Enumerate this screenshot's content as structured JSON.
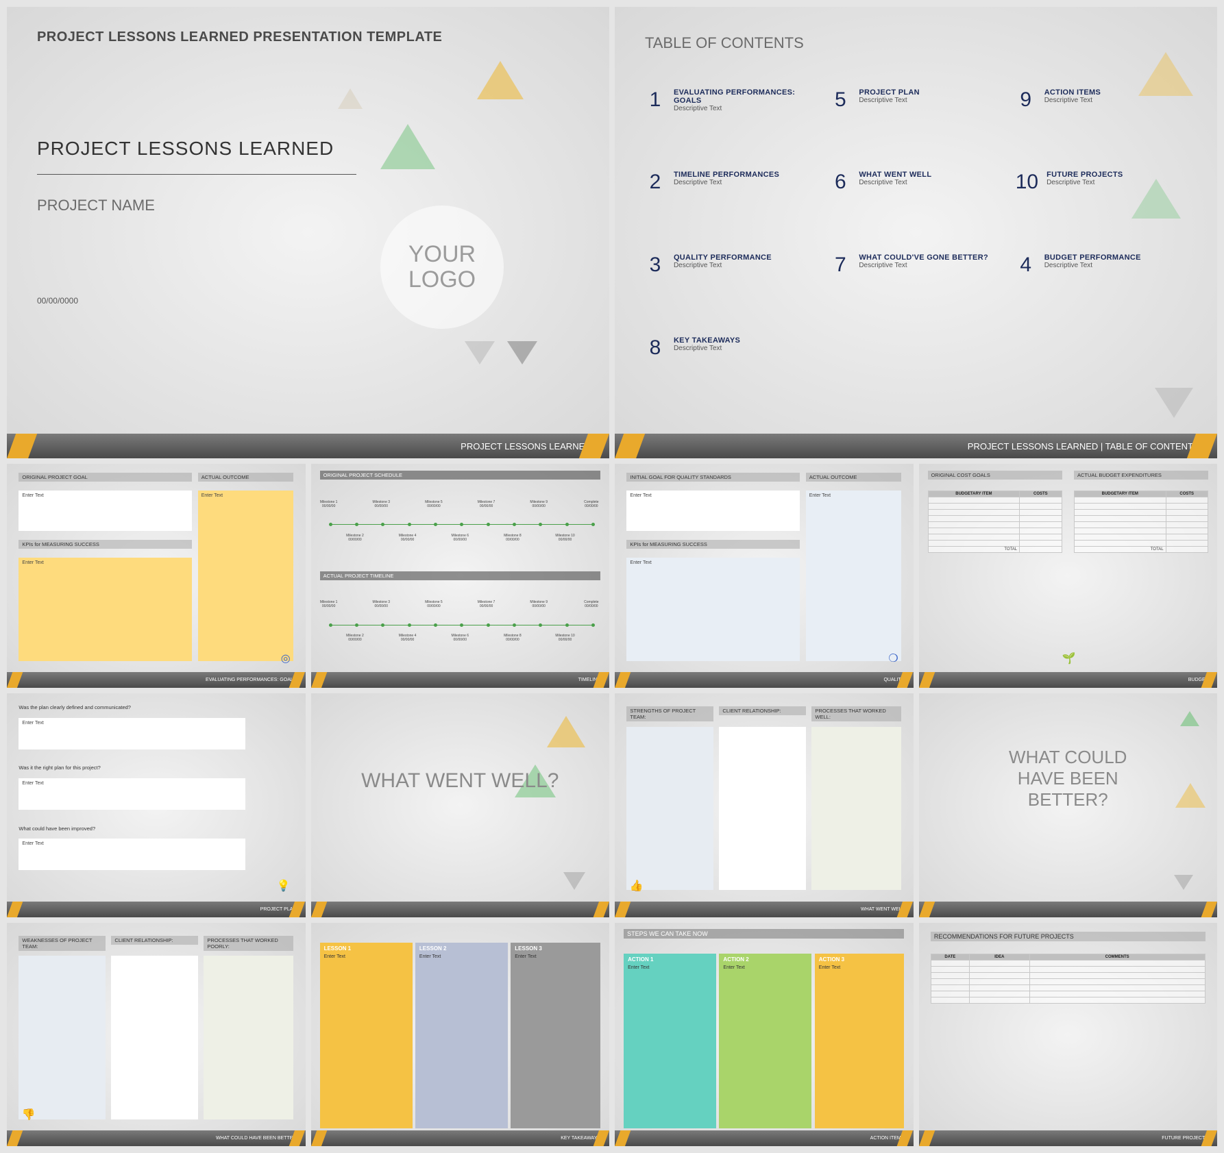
{
  "slide1": {
    "header": "PROJECT LESSONS LEARNED PRESENTATION TEMPLATE",
    "title": "PROJECT LESSONS LEARNED",
    "subtitle": "PROJECT NAME",
    "date": "00/00/0000",
    "logo": "YOUR LOGO",
    "footer": "PROJECT LESSONS LEARNED"
  },
  "slide2": {
    "title": "TABLE OF CONTENTS",
    "items": [
      {
        "n": "1",
        "t": "EVALUATING PERFORMANCES: GOALS",
        "d": "Descriptive Text"
      },
      {
        "n": "5",
        "t": "PROJECT PLAN",
        "d": "Descriptive Text"
      },
      {
        "n": "9",
        "t": "ACTION ITEMS",
        "d": "Descriptive Text"
      },
      {
        "n": "2",
        "t": "TIMELINE PERFORMANCES",
        "d": "Descriptive Text"
      },
      {
        "n": "6",
        "t": "WHAT WENT WELL",
        "d": "Descriptive Text"
      },
      {
        "n": "10",
        "t": "FUTURE PROJECTS",
        "d": "Descriptive Text"
      },
      {
        "n": "3",
        "t": "QUALITY PERFORMANCE",
        "d": "Descriptive Text"
      },
      {
        "n": "7",
        "t": "WHAT COULD'VE GONE BETTER?",
        "d": "Descriptive Text"
      },
      {
        "n": "4",
        "t": "BUDGET PERFORMANCE",
        "d": "Descriptive Text"
      },
      {
        "n": "8",
        "t": "KEY TAKEAWAYS",
        "d": "Descriptive Text"
      }
    ],
    "footer": "PROJECT LESSONS LEARNED   |   TABLE OF CONTENTS"
  },
  "goals": {
    "h1": "ORIGINAL PROJECT GOAL",
    "h2": "ACTUAL OUTCOME",
    "h3": "KPIs for MEASURING SUCCESS",
    "enter": "Enter Text",
    "footer": "EVALUATING PERFORMANCES: GOALS"
  },
  "timeline": {
    "h1": "ORIGINAL PROJECT SCHEDULE",
    "h2": "ACTUAL PROJECT TIMELINE",
    "labels": [
      "Milestone 1",
      "Milestone 3",
      "Milestone 5",
      "Milestone 7",
      "Milestone 9",
      "Complete",
      "Milestone 2",
      "Milestone 4",
      "Milestone 6",
      "Milestone 8",
      "Milestone 10"
    ],
    "date": "00/00/00",
    "footer": "TIMELINE"
  },
  "quality": {
    "h1": "INITIAL GOAL FOR QUALITY STANDARDS",
    "h2": "ACTUAL OUTCOME",
    "h3": "KPIs for MEASURING SUCCESS",
    "enter": "Enter Text",
    "footer": "QUALITY"
  },
  "budget": {
    "h1": "ORIGINAL COST GOALS",
    "h2": "ACTUAL BUDGET EXPENDITURES",
    "col1": "BUDGETARY ITEM",
    "col2": "COSTS",
    "total": "TOTAL",
    "footer": "BUDGET"
  },
  "plan": {
    "q1": "Was the plan clearly defined and communicated?",
    "q2": "Was it the right plan for this project?",
    "q3": "What could have been improved?",
    "enter": "Enter Text",
    "footer": "PROJECT PLAN"
  },
  "wentwell_title": {
    "t": "WHAT WENT WELL?"
  },
  "wentwell": {
    "c1": "STRENGTHS OF PROJECT TEAM:",
    "c2": "CLIENT RELATIONSHIP:",
    "c3": "PROCESSES THAT WORKED WELL:",
    "footer": "WHAT WENT WELL"
  },
  "better_title": {
    "t1": "WHAT COULD",
    "t2": "HAVE BEEN",
    "t3": "BETTER?"
  },
  "better": {
    "c1": "WEAKNESSES OF PROJECT TEAM:",
    "c2": "CLIENT RELATIONSHIP:",
    "c3": "PROCESSES THAT WORKED POORLY:",
    "footer": "WHAT COULD HAVE BEEN BETTER"
  },
  "takeaways": {
    "l": [
      "LESSON 1",
      "LESSON 2",
      "LESSON 3"
    ],
    "enter": "Enter Text",
    "footer": "KEY TAKEAWAYS"
  },
  "actions": {
    "h": "STEPS WE CAN TAKE NOW",
    "a": [
      "ACTION 1",
      "ACTION 2",
      "ACTION 3"
    ],
    "enter": "Enter Text",
    "footer": "ACTION ITEMS"
  },
  "future": {
    "h": "RECOMMENDATIONS FOR FUTURE PROJECTS",
    "cols": [
      "DATE",
      "IDEA",
      "COMMENTS"
    ],
    "footer": "FUTURE PROJECTS"
  }
}
